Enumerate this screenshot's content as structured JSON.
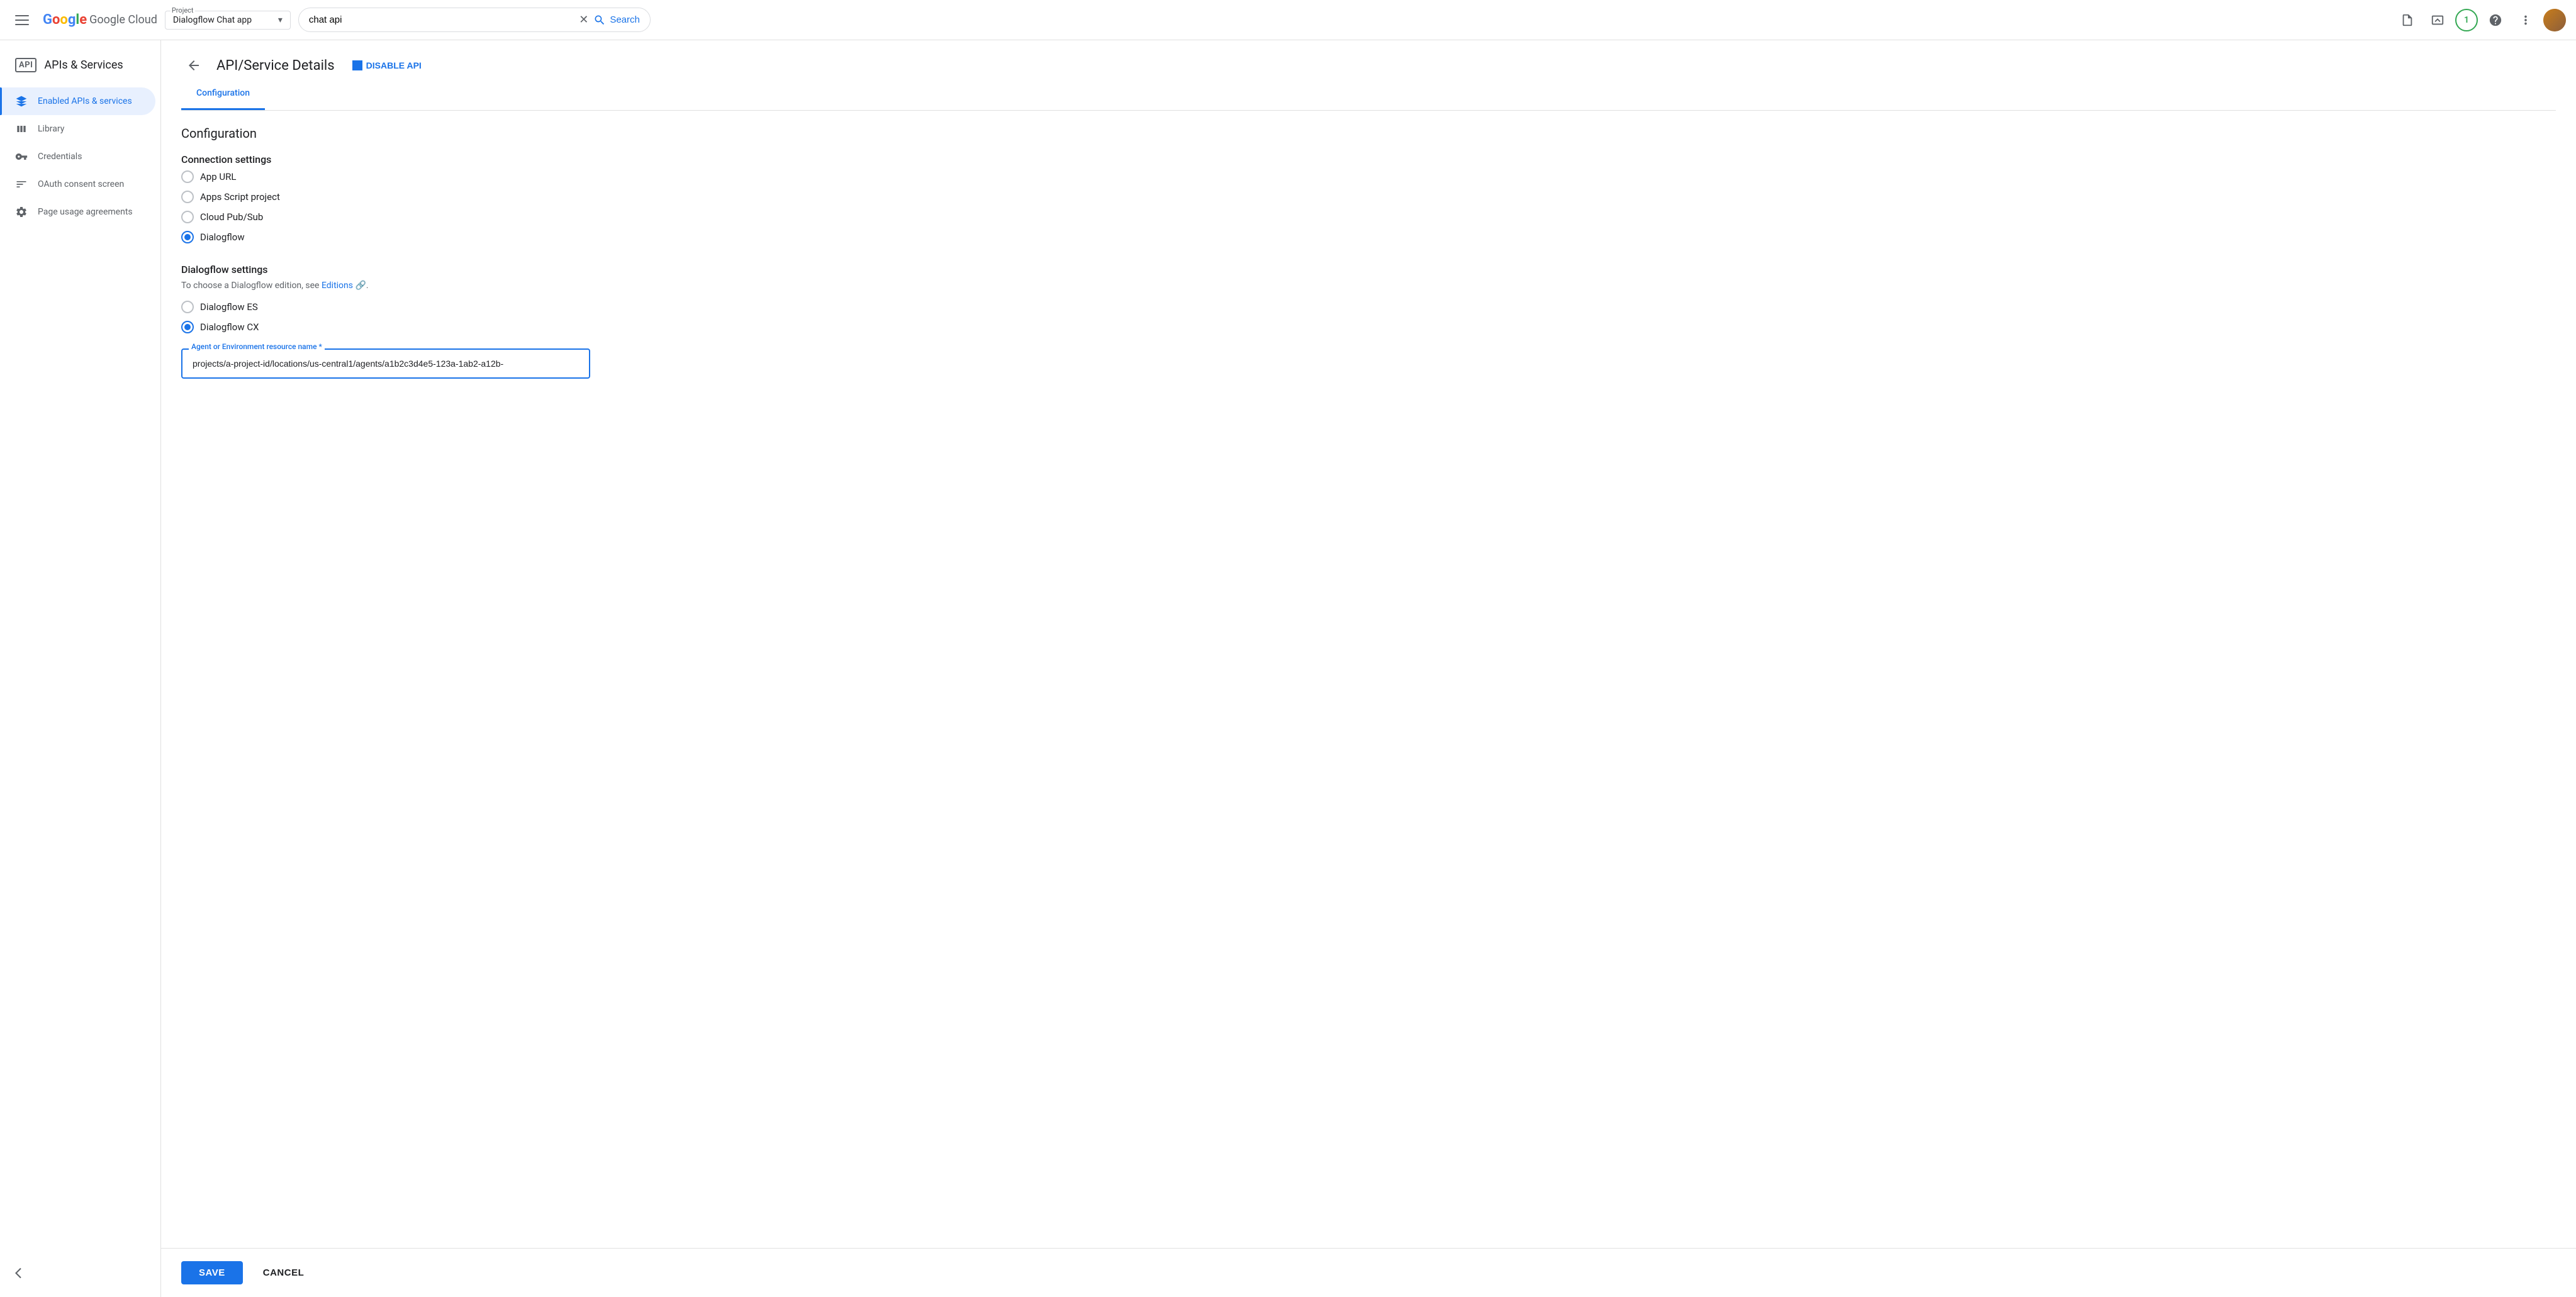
{
  "topbar": {
    "menu_label": "Main menu",
    "logo_text": "Google Cloud",
    "project_label": "Project",
    "project_value": "Dialogflow Chat app",
    "search_placeholder": "chat api",
    "search_value": "chat api",
    "search_button_label": "Search",
    "notification_count": "1",
    "more_options_label": "More options"
  },
  "sidebar": {
    "api_badge": "API",
    "title": "APIs & Services",
    "items": [
      {
        "id": "enabled",
        "label": "Enabled APIs & services",
        "icon": "◈",
        "active": true
      },
      {
        "id": "library",
        "label": "Library",
        "icon": "▦",
        "active": false
      },
      {
        "id": "credentials",
        "label": "Credentials",
        "icon": "🔑",
        "active": false
      },
      {
        "id": "oauth",
        "label": "OAuth consent screen",
        "icon": "⋮⋮⋮",
        "active": false
      },
      {
        "id": "page-usage",
        "label": "Page usage agreements",
        "icon": "⚙",
        "active": false
      }
    ],
    "collapse_label": "Collapse navigation"
  },
  "header": {
    "back_label": "Back",
    "title": "API/Service Details",
    "disable_api_label": "DISABLE API",
    "tab_active": "Configuration"
  },
  "configuration": {
    "heading": "Configuration",
    "connection_settings_heading": "Connection settings",
    "radio_options": [
      {
        "id": "app-url",
        "label": "App URL",
        "checked": false
      },
      {
        "id": "apps-script",
        "label": "Apps Script project",
        "checked": false
      },
      {
        "id": "cloud-pubsub",
        "label": "Cloud Pub/Sub",
        "checked": false
      },
      {
        "id": "dialogflow",
        "label": "Dialogflow",
        "checked": true
      }
    ],
    "dialogflow_settings_heading": "Dialogflow settings",
    "dialogflow_desc_prefix": "To choose a Dialogflow edition, see ",
    "dialogflow_editions_link": "Editions",
    "dialogflow_desc_suffix": ".",
    "dialogflow_radio_options": [
      {
        "id": "df-es",
        "label": "Dialogflow ES",
        "checked": false
      },
      {
        "id": "df-cx",
        "label": "Dialogflow CX",
        "checked": true
      }
    ],
    "resource_field_label": "Agent or Environment resource name *",
    "resource_field_value": "projects/a-project-id/locations/us-central1/agents/a1b2c3d4e5-123a-1ab2-a12b-"
  },
  "footer": {
    "save_label": "SAVE",
    "cancel_label": "CANCEL"
  }
}
